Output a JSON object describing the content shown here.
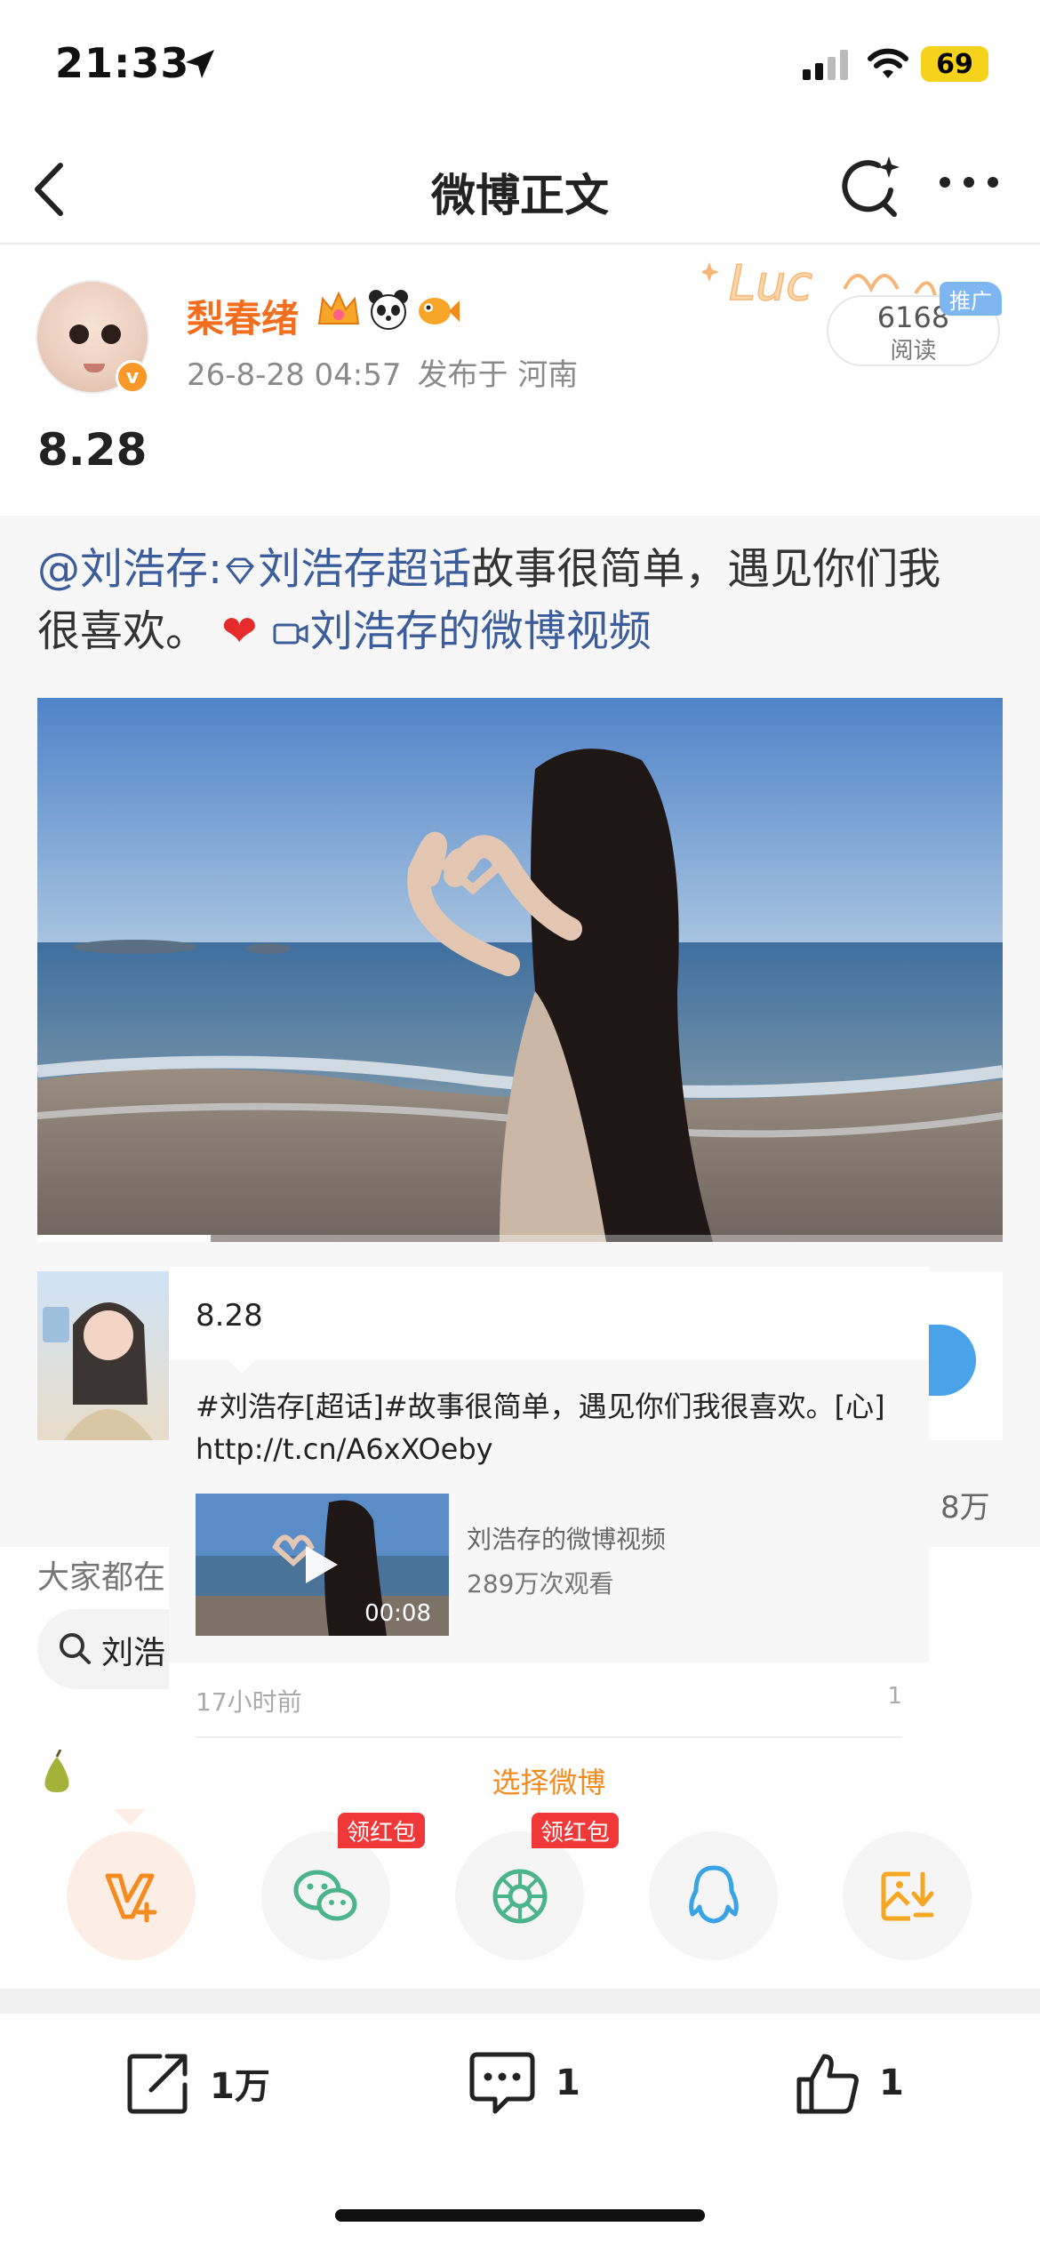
{
  "status_bar": {
    "time": "21:33",
    "battery": "69",
    "icons": [
      "location-arrow-icon",
      "cellular-signal-icon",
      "wifi-icon",
      "battery-icon"
    ]
  },
  "nav": {
    "title": "微博正文",
    "icons": [
      "back-icon",
      "refresh-search-icon",
      "more-icon"
    ]
  },
  "author": {
    "name": "梨春绪",
    "badges": [
      "crown-badge",
      "panda-badge",
      "fish-badge"
    ],
    "verified_mark": "v",
    "date": "26-8-28 04:57",
    "location": "发布于 河南",
    "read_count": "6168",
    "read_label": "阅读",
    "promo_label": "推广"
  },
  "post": {
    "text": "8.28"
  },
  "repost": {
    "mention": "@刘浩存:",
    "topic": "刘浩存超话",
    "text_a": "故事很简单，遇见你们我",
    "text_b": "很喜欢。",
    "heart": "❤",
    "video_link": "刘浩存的微博视频",
    "video_progress": 0.18,
    "side_count": "8万"
  },
  "popup": {
    "title": "8.28",
    "body_line1": "#刘浩存[超话]#故事很简单，遇见你们我很喜欢。[心]",
    "body_line2": "http://t.cn/A6xXOeby",
    "video_title": "刘浩存的微博视频",
    "video_views": "289万次观看",
    "duration": "00:08",
    "time": "17小时前",
    "count": "1",
    "choose": "选择微博"
  },
  "recommend": {
    "label": "大家都在",
    "search_text": "刘浩"
  },
  "share": {
    "items": [
      {
        "name": "weibo-share",
        "icon": "weibo-plus-icon",
        "tag": ""
      },
      {
        "name": "wechat-share",
        "icon": "wechat-icon",
        "tag": "领红包"
      },
      {
        "name": "moments-share",
        "icon": "moments-icon",
        "tag": "领红包"
      },
      {
        "name": "qq-share",
        "icon": "qq-icon",
        "tag": ""
      },
      {
        "name": "save-image",
        "icon": "save-image-icon",
        "tag": ""
      }
    ]
  },
  "actions": {
    "repost": "1万",
    "comment": "1",
    "like": "1"
  },
  "colors": {
    "accent": "#f36e1f",
    "link": "#3c5d9b",
    "orange_cta": "#f58a1f",
    "red_tag": "#f03838"
  }
}
